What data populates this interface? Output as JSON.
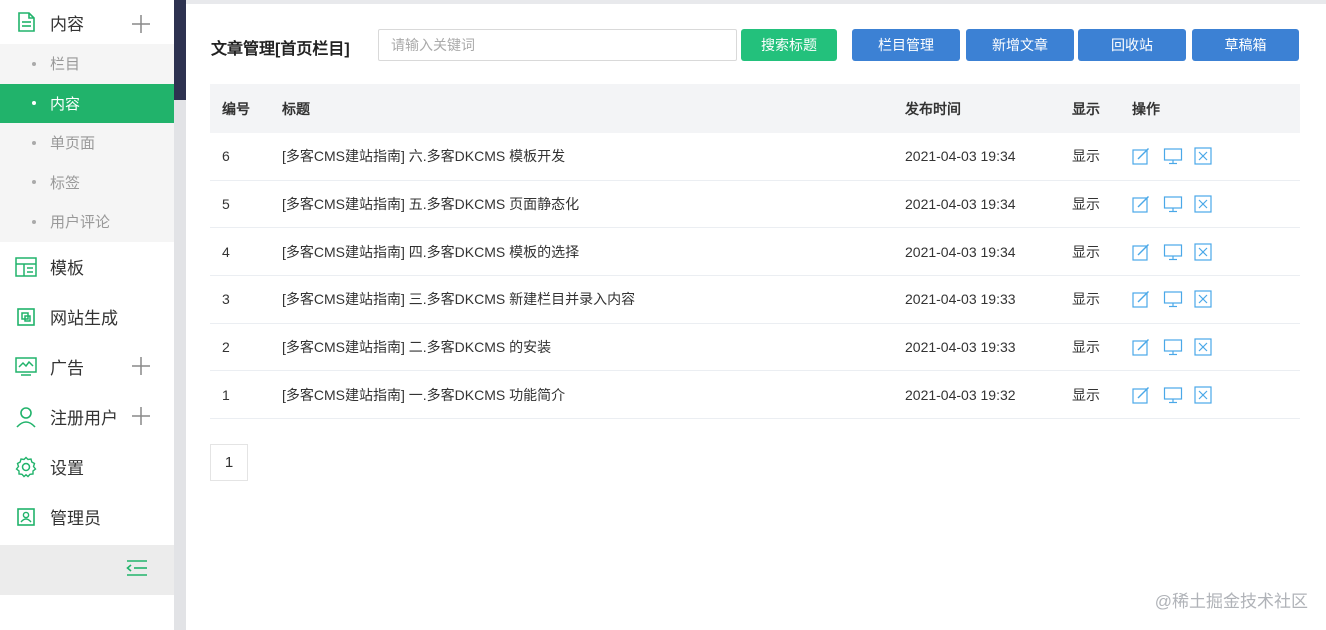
{
  "sidebar": {
    "content_group": {
      "label": "内容",
      "icon": "document-icon"
    },
    "content_items": [
      {
        "label": "栏目",
        "active": false
      },
      {
        "label": "内容",
        "active": true
      },
      {
        "label": "单页面",
        "active": false
      },
      {
        "label": "标签",
        "active": false
      },
      {
        "label": "用户评论",
        "active": false
      }
    ],
    "groups": [
      {
        "label": "模板",
        "icon": "layout-icon",
        "expandable": false
      },
      {
        "label": "网站生成",
        "icon": "generate-icon",
        "expandable": false
      },
      {
        "label": "广告",
        "icon": "chart-monitor-icon",
        "expandable": true
      },
      {
        "label": "注册用户",
        "icon": "user-icon",
        "expandable": true
      },
      {
        "label": "设置",
        "icon": "gear-icon",
        "expandable": false
      },
      {
        "label": "管理员",
        "icon": "admin-badge-icon",
        "expandable": false
      }
    ],
    "accent_color": "#21b36b"
  },
  "header": {
    "title": "文章管理[首页栏目]",
    "search_placeholder": "请输入关键词",
    "search_button": "搜索标题",
    "buttons": [
      "栏目管理",
      "新增文章",
      "回收站",
      "草稿箱"
    ]
  },
  "table": {
    "columns": [
      "编号",
      "标题",
      "发布时间",
      "显示",
      "操作"
    ],
    "rows": [
      {
        "id": "6",
        "title": "[多客CMS建站指南] 六.多客DKCMS 模板开发",
        "time": "2021-04-03 19:34",
        "show": "显示"
      },
      {
        "id": "5",
        "title": "[多客CMS建站指南] 五.多客DKCMS 页面静态化",
        "time": "2021-04-03 19:34",
        "show": "显示"
      },
      {
        "id": "4",
        "title": "[多客CMS建站指南] 四.多客DKCMS 模板的选择",
        "time": "2021-04-03 19:34",
        "show": "显示"
      },
      {
        "id": "3",
        "title": "[多客CMS建站指南] 三.多客DKCMS 新建栏目并录入内容",
        "time": "2021-04-03 19:33",
        "show": "显示"
      },
      {
        "id": "2",
        "title": "[多客CMS建站指南] 二.多客DKCMS 的安装",
        "time": "2021-04-03 19:33",
        "show": "显示"
      },
      {
        "id": "1",
        "title": "[多客CMS建站指南] 一.多客DKCMS 功能简介",
        "time": "2021-04-03 19:32",
        "show": "显示"
      }
    ],
    "op_icons": [
      "edit-icon",
      "preview-monitor-icon",
      "delete-icon"
    ]
  },
  "pagination": {
    "current": "1"
  },
  "watermark": "@稀土掘金技术社区"
}
